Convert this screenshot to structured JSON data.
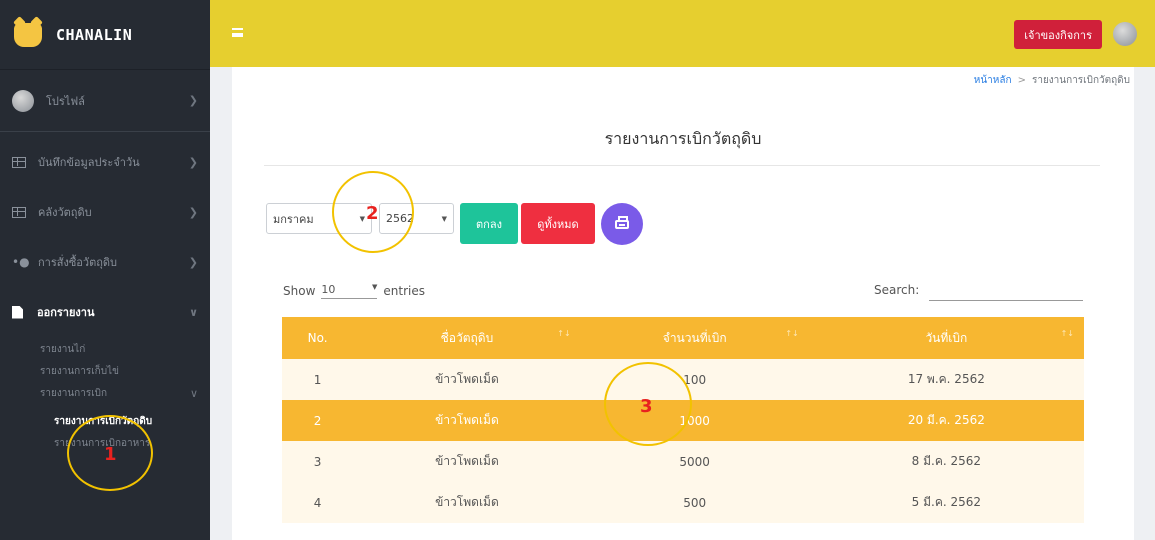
{
  "brand": {
    "name": "CHANALIN"
  },
  "sidebar": {
    "profile_label": "โปรไฟล์",
    "items": [
      {
        "label": "บันทึกข้อมูลประจำวัน"
      },
      {
        "label": "คลังวัตถุดิบ"
      },
      {
        "label": "การสั่งซื้อวัตถุดิบ"
      }
    ],
    "report_label": "ออกรายงาน",
    "sub_items": [
      {
        "label": "รายงานไก่"
      },
      {
        "label": "รายงานการเก็บไข่"
      },
      {
        "label": "รายงานการเบิก"
      }
    ],
    "deep_items": [
      {
        "label": "รายงานการเบิกวัตถุดิบ"
      },
      {
        "label": "รายงานการเบิกอาหาร"
      }
    ]
  },
  "topbar": {
    "owner_label": "เจ้าของกิจการ"
  },
  "breadcrumb": {
    "home": "หน้าหลัก",
    "current": "รายงานการเบิกวัตถุดิบ"
  },
  "page": {
    "title": "รายงานการเบิกวัตถุดิบ"
  },
  "filters": {
    "month": "มกราคม",
    "year": "2562",
    "ok_label": "ตกลง",
    "show_all_label": "ดูทั้งหมด"
  },
  "datatable": {
    "show_label": "Show",
    "length": "10",
    "entries_label": "entries",
    "search_label": "Search:",
    "columns": [
      "No.",
      "ชื่อวัตถุดิบ",
      "จำนวนที่เบิก",
      "วันที่เบิก"
    ],
    "rows": [
      [
        "1",
        "ข้าวโพดเม็ด",
        "100",
        "17 พ.ค. 2562"
      ],
      [
        "2",
        "ข้าวโพดเม็ด",
        "1000",
        "20 มี.ค. 2562"
      ],
      [
        "3",
        "ข้าวโพดเม็ด",
        "5000",
        "8 มี.ค. 2562"
      ],
      [
        "4",
        "ข้าวโพดเม็ด",
        "500",
        "5 มี.ค. 2562"
      ]
    ]
  },
  "annotations": [
    "1",
    "2",
    "3"
  ],
  "colors": {
    "topbar": "#e6cf2f",
    "sidebar": "#262b33",
    "table_header": "#f7b731",
    "owner_button": "#d0203a",
    "ok_button": "#1ec49a",
    "show_all_button": "#ef2f40",
    "print_button": "#7a5be8",
    "annotation_ring": "#f2c200"
  }
}
